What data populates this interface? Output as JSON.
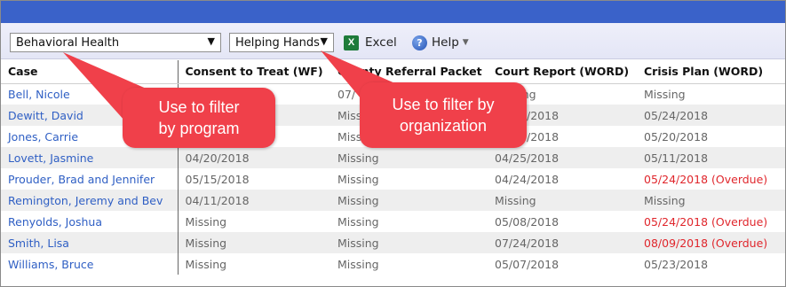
{
  "toolbar": {
    "program_select": "Behavioral Health",
    "org_select": "Helping Hands",
    "excel_label": "Excel",
    "help_label": "Help"
  },
  "table": {
    "headers": [
      "Case",
      "Consent to Treat (WF)",
      "County Referral Packet",
      "Court Report (WORD)",
      "Crisis Plan (WORD)"
    ],
    "rows": [
      [
        "Bell, Nicole",
        "",
        "07/",
        "Missing",
        "Missing"
      ],
      [
        "Dewitt, David",
        "",
        "Missing",
        "05/24/2018",
        "05/24/2018"
      ],
      [
        "Jones, Carrie",
        "",
        "Missing",
        "05/04/2018",
        "05/20/2018"
      ],
      [
        "Lovett, Jasmine",
        "04/20/2018",
        "Missing",
        "04/25/2018",
        "05/11/2018"
      ],
      [
        "Prouder, Brad and Jennifer",
        "05/15/2018",
        "Missing",
        "04/24/2018",
        "05/24/2018 (Overdue)"
      ],
      [
        "Remington, Jeremy and Bev",
        "04/11/2018",
        "Missing",
        "Missing",
        "Missing"
      ],
      [
        "Renyolds, Joshua",
        "Missing",
        "Missing",
        "05/08/2018",
        "05/24/2018 (Overdue)"
      ],
      [
        "Smith, Lisa",
        "Missing",
        "Missing",
        "07/24/2018",
        "08/09/2018 (Overdue)"
      ],
      [
        "Williams, Bruce",
        "Missing",
        "Missing",
        "05/07/2018",
        "05/23/2018"
      ]
    ]
  },
  "callouts": {
    "program_line1": "Use to filter",
    "program_line2": "by program",
    "org_line1": "Use to filter by",
    "org_line2": "organization"
  },
  "colors": {
    "topbar": "#3a62c9",
    "link": "#2f5fc4",
    "overdue": "#e0262c",
    "callout": "#f0404a"
  }
}
